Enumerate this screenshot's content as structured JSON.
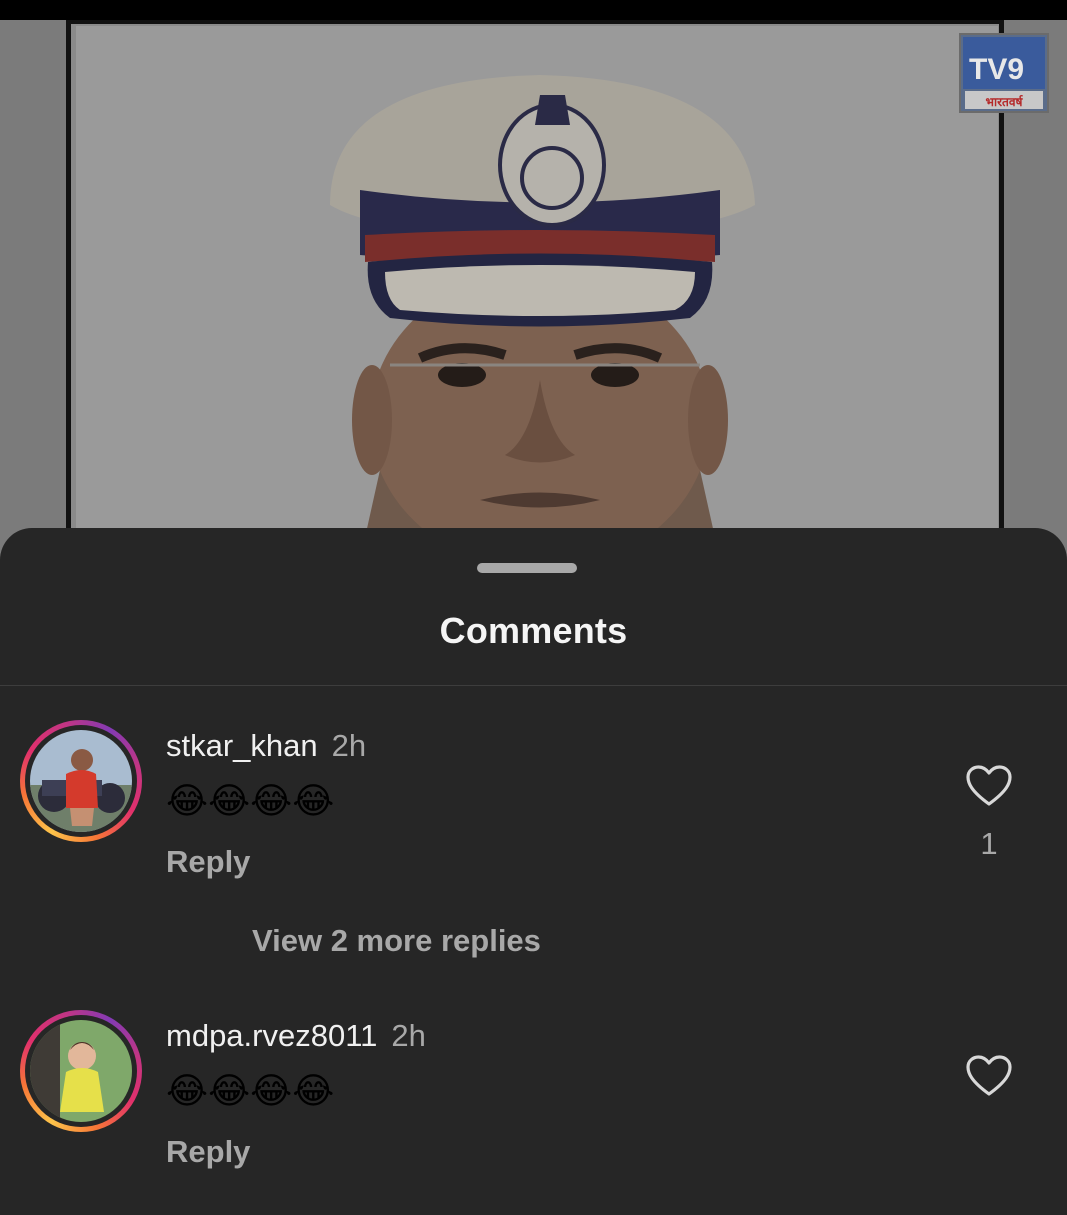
{
  "post": {
    "channel_logo_text": "TV9",
    "channel_logo_subtext": "भारतवर्ष",
    "image_icon": "police-officer-portrait"
  },
  "sheet": {
    "title": "Comments"
  },
  "comments": [
    {
      "username": "stkar_khan",
      "time": "2h",
      "text": "😂😂😂😂",
      "reply_label": "Reply",
      "like_count": "1",
      "view_replies_label": "View 2 more replies",
      "avatar_icon": "avatar-motorcycle-user"
    },
    {
      "username": "mdpa.rvez8011",
      "time": "2h",
      "text": "😂😂😂😂",
      "reply_label": "Reply",
      "avatar_icon": "avatar-child-user"
    }
  ],
  "colors": {
    "sheet_bg": "#262626",
    "primary_text": "#f0f0f0",
    "secondary_text": "#a8a8a8",
    "story_ring": [
      "#fdc34a",
      "#e1306c",
      "#833ab4"
    ]
  }
}
